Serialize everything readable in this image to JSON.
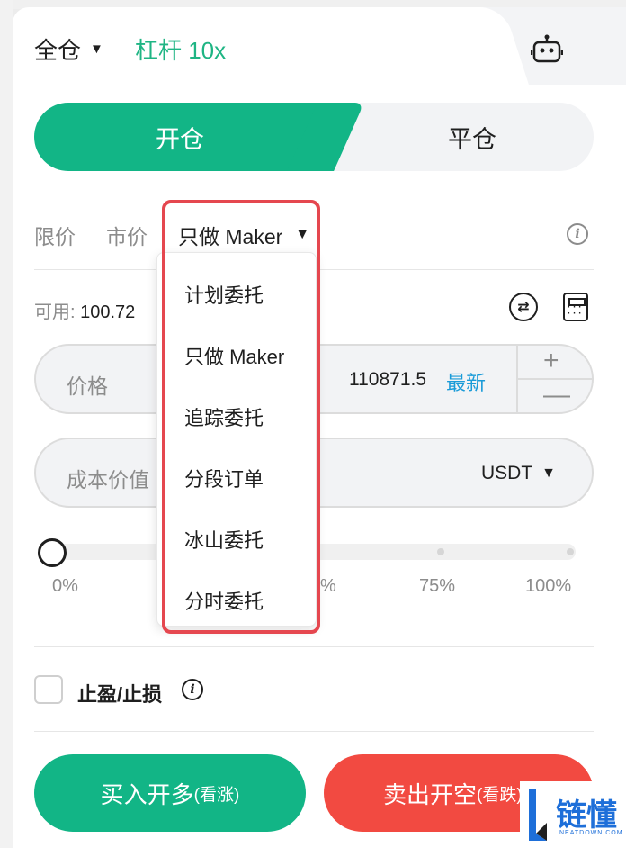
{
  "header": {
    "margin_mode": "全仓",
    "leverage": "杠杆 10x"
  },
  "tabs": {
    "open": "开仓",
    "close": "平仓"
  },
  "order_types": {
    "limit": "限价",
    "market": "市价",
    "selected": "只做 Maker"
  },
  "available": {
    "label": "可用:",
    "value": "100.72"
  },
  "price_field": {
    "label": "价格",
    "value": "110871.5",
    "latest": "最新"
  },
  "cost_field": {
    "label": "成本价值",
    "currency": "USDT"
  },
  "slider": {
    "ticks": [
      "0%",
      "%",
      "75%",
      "100%"
    ],
    "position": 0
  },
  "tpsl": {
    "label": "止盈/止损"
  },
  "buttons": {
    "buy_main": "买入开多",
    "buy_sub": "(看涨)",
    "sell_main": "卖出开空",
    "sell_sub": "(看跌)"
  },
  "dropdown": {
    "items": [
      "计划委托",
      "只做 Maker",
      "追踪委托",
      "分段订单",
      "冰山委托",
      "分时委托"
    ]
  },
  "watermark": {
    "text": "链懂",
    "sub": "NEATDOWN.COM"
  },
  "colors": {
    "green": "#12b586",
    "red": "#f24a41",
    "blue": "#1a9bd8",
    "highlight": "#e5474f"
  }
}
